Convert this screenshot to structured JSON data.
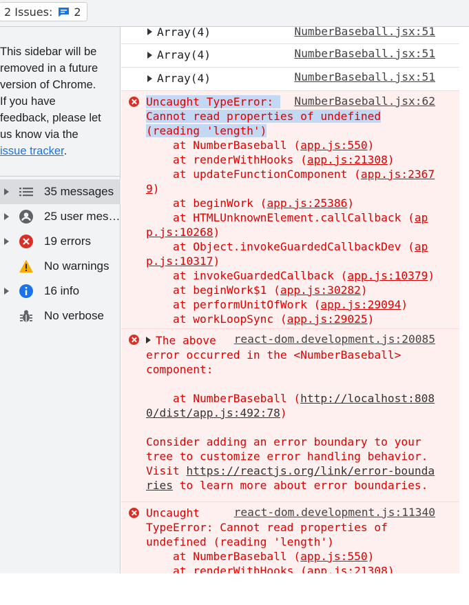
{
  "topbar": {
    "issues_label": "2 Issues:",
    "issues_count": "2"
  },
  "sidebar": {
    "notice_lines": [
      "This sidebar will be",
      "removed in a future",
      "version of Chrome.",
      "If you have",
      "feedback, please let",
      "us know via the"
    ],
    "notice_link": "issue tracker",
    "notice_end": ".",
    "filters": [
      {
        "label": "35 messages",
        "icon": "list-icon"
      },
      {
        "label": "25 user mes…",
        "icon": "user-icon"
      },
      {
        "label": "19 errors",
        "icon": "error-icon"
      },
      {
        "label": "No warnings",
        "icon": "warning-icon"
      },
      {
        "label": "16 info",
        "icon": "info-icon"
      },
      {
        "label": "No verbose",
        "icon": "bug-icon"
      }
    ]
  },
  "console": {
    "logs": [
      {
        "text": "Array(4)",
        "source": "NumberBaseball.jsx:51"
      },
      {
        "text": "Array(4)",
        "source": "NumberBaseball.jsx:51"
      },
      {
        "text": "Array(4)",
        "source": "NumberBaseball.jsx:51"
      }
    ],
    "error1": {
      "source": "NumberBaseball.jsx:62",
      "l1": "Uncaught TypeError: ",
      "l2": "Cannot read properties of undefined",
      "l3": "(reading 'length')",
      "stack": [
        {
          "pre": "    at NumberBaseball (",
          "link": "app.js:550",
          "post": ")"
        },
        {
          "pre": "    at renderWithHooks (",
          "link": "app.js:21308",
          "post": ")"
        },
        {
          "pre": "    at updateFunctionComponent (",
          "link": "app.js:2367",
          "post": ""
        },
        {
          "pre": "",
          "link": "9",
          "post": ")"
        },
        {
          "pre": "    at beginWork (",
          "link": "app.js:25386",
          "post": ")"
        },
        {
          "pre": "    at HTMLUnknownElement.callCallback (",
          "link": "ap",
          "post": ""
        },
        {
          "pre": "",
          "link": "p.js:10268",
          "post": ")"
        },
        {
          "pre": "    at Object.invokeGuardedCallbackDev (",
          "link": "ap",
          "post": ""
        },
        {
          "pre": "",
          "link": "p.js:10317",
          "post": ")"
        },
        {
          "pre": "    at invokeGuardedCallback (",
          "link": "app.js:10379",
          "post": ")"
        },
        {
          "pre": "    at beginWork$1 (",
          "link": "app.js:30282",
          "post": ")"
        },
        {
          "pre": "    at performUnitOfWork (",
          "link": "app.js:29094",
          "post": ")"
        },
        {
          "pre": "    at workLoopSync (",
          "link": "app.js:29025",
          "post": ")"
        }
      ]
    },
    "error2": {
      "source": "react-dom.development.js:20085",
      "l1": "The above ",
      "l2": "error occurred in the <NumberBaseball>",
      "l3": "component:",
      "l4pre": "    at NumberBaseball (",
      "l4link": "http://localhost:808",
      "l5link": "0/dist/app.js:492:78",
      "l5post": ")",
      "l6": "Consider adding an error boundary to your",
      "l7": "tree to customize error handling behavior.",
      "l8pre": "Visit ",
      "l8link": "https://reactjs.org/link/error-bounda",
      "l9link": "ries",
      "l9post": " to learn more about error boundaries."
    },
    "error3": {
      "source": "react-dom.development.js:11340",
      "l1": "Uncaught",
      "l2": "TypeError: Cannot read properties of",
      "l3": "undefined (reading 'length')",
      "stack": [
        {
          "pre": "    at NumberBaseball (",
          "link": "app.js:550",
          "post": ")"
        },
        {
          "pre": "    at renderWithHooks (",
          "link": "app.js:21308",
          "post": ")"
        }
      ]
    }
  },
  "colors": {
    "error_text": "#dd0000",
    "error_bg": "#fff0f0",
    "selection": "#c3d8f2",
    "link_blue": "#1a73e8"
  }
}
